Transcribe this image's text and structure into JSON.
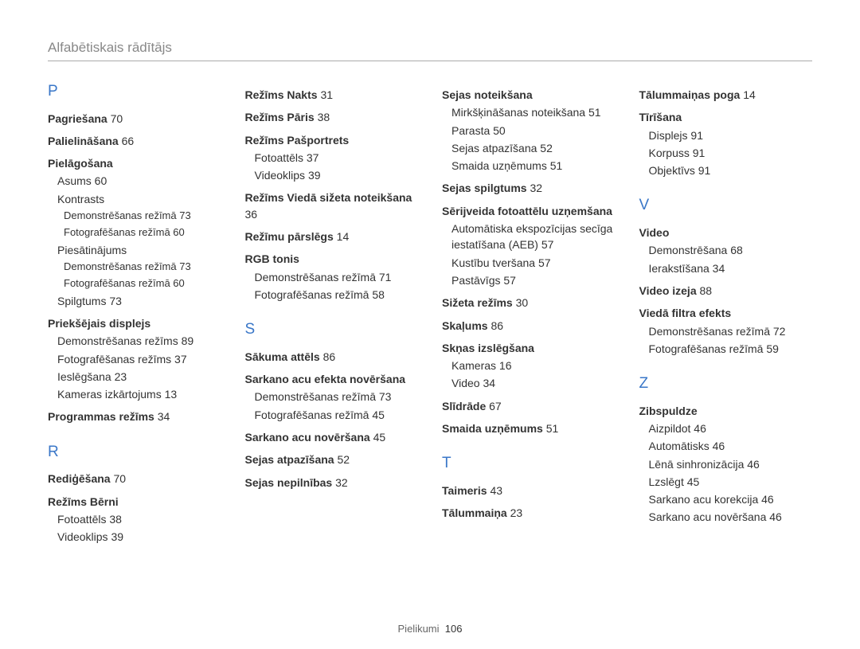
{
  "header": {
    "title": "Alfabētiskais rādītājs"
  },
  "footer": {
    "label": "Pielikumi",
    "page": "106"
  },
  "columns": [
    [
      {
        "type": "letter",
        "text": "P"
      },
      {
        "type": "entry",
        "text": "Pagriešana",
        "page": "70"
      },
      {
        "type": "entry",
        "text": "Palielināšana",
        "page": "66"
      },
      {
        "type": "entry",
        "text": "Pielāgošana"
      },
      {
        "type": "sub",
        "text": "Asums",
        "page": "60"
      },
      {
        "type": "sub",
        "text": "Kontrasts"
      },
      {
        "type": "subsub",
        "text": "Demonstrēšanas režīmā",
        "page": "73"
      },
      {
        "type": "subsub",
        "text": "Fotografēšanas režīmā",
        "page": "60"
      },
      {
        "type": "sub",
        "text": "Piesātinājums"
      },
      {
        "type": "subsub",
        "text": "Demonstrēšanas režīmā",
        "page": "73"
      },
      {
        "type": "subsub",
        "text": "Fotografēšanas režīmā",
        "page": "60"
      },
      {
        "type": "sub",
        "text": "Spilgtums",
        "page": "73"
      },
      {
        "type": "entry",
        "text": "Priekšējais displejs"
      },
      {
        "type": "sub",
        "text": "Demonstrēšanas režīms",
        "page": "89"
      },
      {
        "type": "sub",
        "text": "Fotografēšanas režīms",
        "page": "37"
      },
      {
        "type": "sub",
        "text": "Ieslēgšana",
        "page": "23"
      },
      {
        "type": "sub",
        "text": "Kameras izkārtojums",
        "page": "13"
      },
      {
        "type": "entry",
        "text": "Programmas režīms",
        "page": "34"
      },
      {
        "type": "letter",
        "text": "R"
      },
      {
        "type": "entry",
        "text": "Rediģēšana",
        "page": "70"
      },
      {
        "type": "entry",
        "text": "Režīms Bērni"
      },
      {
        "type": "sub",
        "text": "Fotoattēls",
        "page": "38"
      },
      {
        "type": "sub",
        "text": "Videoklips",
        "page": "39"
      }
    ],
    [
      {
        "type": "entry",
        "text": "Režīms Nakts",
        "page": "31"
      },
      {
        "type": "entry",
        "text": "Režīms Pāris",
        "page": "38"
      },
      {
        "type": "entry",
        "text": "Režīms Pašportrets"
      },
      {
        "type": "sub",
        "text": "Fotoattēls",
        "page": "37"
      },
      {
        "type": "sub",
        "text": "Videoklips",
        "page": "39"
      },
      {
        "type": "entry",
        "text": "Režīms Viedā sižeta noteikšana",
        "page": "36"
      },
      {
        "type": "entry",
        "text": "Režīmu pārslēgs",
        "page": "14"
      },
      {
        "type": "entry",
        "text": "RGB tonis"
      },
      {
        "type": "sub",
        "text": "Demonstrēšanas režīmā",
        "page": "71"
      },
      {
        "type": "sub",
        "text": "Fotografēšanas režīmā",
        "page": "58"
      },
      {
        "type": "letter",
        "text": "S"
      },
      {
        "type": "entry",
        "text": "Sākuma attēls",
        "page": "86"
      },
      {
        "type": "entry",
        "text": "Sarkano acu efekta novēršana"
      },
      {
        "type": "sub",
        "text": "Demonstrēšanas režīmā",
        "page": "73"
      },
      {
        "type": "sub",
        "text": "Fotografēšanas režīmā",
        "page": "45"
      },
      {
        "type": "entry",
        "text": "Sarkano acu novēršana",
        "page": "45"
      },
      {
        "type": "entry",
        "text": "Sejas atpazīšana",
        "page": "52"
      },
      {
        "type": "entry",
        "text": "Sejas nepilnības",
        "page": "32"
      }
    ],
    [
      {
        "type": "entry",
        "text": "Sejas noteikšana"
      },
      {
        "type": "sub",
        "text": "Mirkšķināšanas noteikšana",
        "page": "51"
      },
      {
        "type": "sub",
        "text": "Parasta",
        "page": "50"
      },
      {
        "type": "sub",
        "text": "Sejas atpazīšana",
        "page": "52"
      },
      {
        "type": "sub",
        "text": "Smaida uzņēmums",
        "page": "51"
      },
      {
        "type": "entry",
        "text": "Sejas spilgtums",
        "page": "32"
      },
      {
        "type": "entry",
        "text": "Sērijveida fotoattēlu uzņemšana"
      },
      {
        "type": "sub",
        "text": "Automātiska ekspozīcijas secīga iestatīšana (AEB)",
        "page": "57"
      },
      {
        "type": "sub",
        "text": "Kustību tveršana",
        "page": "57"
      },
      {
        "type": "sub",
        "text": "Pastāvīgs",
        "page": "57"
      },
      {
        "type": "entry",
        "text": "Sižeta režīms",
        "page": "30"
      },
      {
        "type": "entry",
        "text": "Skaļums",
        "page": "86"
      },
      {
        "type": "entry",
        "text": "Skņas izslēgšana"
      },
      {
        "type": "sub",
        "text": "Kameras",
        "page": "16"
      },
      {
        "type": "sub",
        "text": "Video",
        "page": "34"
      },
      {
        "type": "entry",
        "text": "Slīdrāde",
        "page": "67"
      },
      {
        "type": "entry",
        "text": "Smaida uzņēmums",
        "page": "51"
      },
      {
        "type": "letter",
        "text": "T"
      },
      {
        "type": "entry",
        "text": "Taimeris",
        "page": "43"
      },
      {
        "type": "entry",
        "text": "Tālummaiņa",
        "page": "23"
      }
    ],
    [
      {
        "type": "entry",
        "text": "Tālummaiņas poga",
        "page": "14"
      },
      {
        "type": "entry",
        "text": "Tīrīšana"
      },
      {
        "type": "sub",
        "text": "Displejs",
        "page": "91"
      },
      {
        "type": "sub",
        "text": "Korpuss",
        "page": "91"
      },
      {
        "type": "sub",
        "text": "Objektīvs",
        "page": "91"
      },
      {
        "type": "letter",
        "text": "V"
      },
      {
        "type": "entry",
        "text": "Video"
      },
      {
        "type": "sub",
        "text": "Demonstrēšana",
        "page": "68"
      },
      {
        "type": "sub",
        "text": "Ierakstīšana",
        "page": "34"
      },
      {
        "type": "entry",
        "text": "Video izeja",
        "page": "88"
      },
      {
        "type": "entry",
        "text": "Viedā filtra efekts"
      },
      {
        "type": "sub",
        "text": "Demonstrēšanas režīmā",
        "page": "72"
      },
      {
        "type": "sub",
        "text": "Fotografēšanas režīmā",
        "page": "59"
      },
      {
        "type": "letter",
        "text": "Z"
      },
      {
        "type": "entry",
        "text": "Zibspuldze"
      },
      {
        "type": "sub",
        "text": "Aizpildot",
        "page": "46"
      },
      {
        "type": "sub",
        "text": "Automātisks",
        "page": "46"
      },
      {
        "type": "sub",
        "text": "Lēnā sinhronizācija",
        "page": "46"
      },
      {
        "type": "sub",
        "text": "Lzslēgt",
        "page": "45"
      },
      {
        "type": "sub",
        "text": "Sarkano acu korekcija",
        "page": "46"
      },
      {
        "type": "sub",
        "text": "Sarkano acu novēršana",
        "page": "46"
      }
    ]
  ]
}
